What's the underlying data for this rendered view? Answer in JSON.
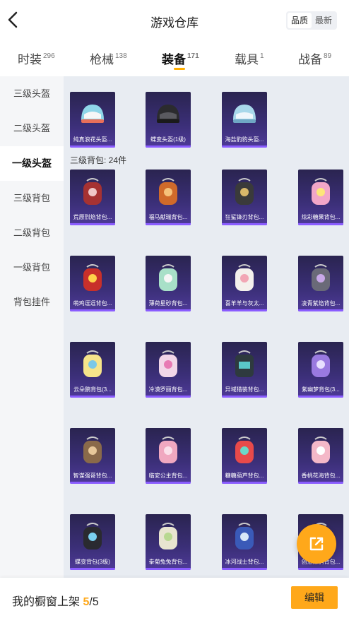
{
  "header": {
    "title": "游戏仓库",
    "sort": [
      "品质",
      "最新"
    ]
  },
  "tabs": [
    {
      "label": "时装",
      "count": "296"
    },
    {
      "label": "枪械",
      "count": "138"
    },
    {
      "label": "装备",
      "count": "171"
    },
    {
      "label": "载具",
      "count": "1"
    },
    {
      "label": "战备",
      "count": "89"
    }
  ],
  "sidebar": [
    "三级头盔",
    "二级头盔",
    "一级头盔",
    "三级背包",
    "二级背包",
    "一级背包",
    "背包挂件"
  ],
  "helmets": [
    "纯真浪花头盔...",
    "蝶变头盔(1级)",
    "海盐豹豹头盔..."
  ],
  "backpack_section": "三级背包: 24件",
  "backpacks": [
    "荒原烈焰背包...",
    "福马献瑞背包...",
    "狂鲨锋刃背包...",
    "炫彩糖果背包...",
    "萌鸡逗逗背包...",
    "薄荷星砂背包...",
    "喜羊羊与灰太...",
    "凌青紫焰背包...",
    "云朵鹅背包(3...",
    "冷漠罗丽背包...",
    "异域猎装背包...",
    "紫幽梦背包(3...",
    "智谋强哥背包...",
    "临安公主背包...",
    "糖糖葫芦背包...",
    "香桃花海背包...",
    "蝶变背包(3级)",
    "拳菊兔兔背包...",
    "冰河战士背包...",
    "创意涂鸦背包..."
  ],
  "footer": {
    "label": "我的橱窗上架",
    "current": "5",
    "total": "/5",
    "edit": "编辑"
  },
  "colors": {
    "accent": "#ffa81a",
    "card": "#3b2f78"
  }
}
